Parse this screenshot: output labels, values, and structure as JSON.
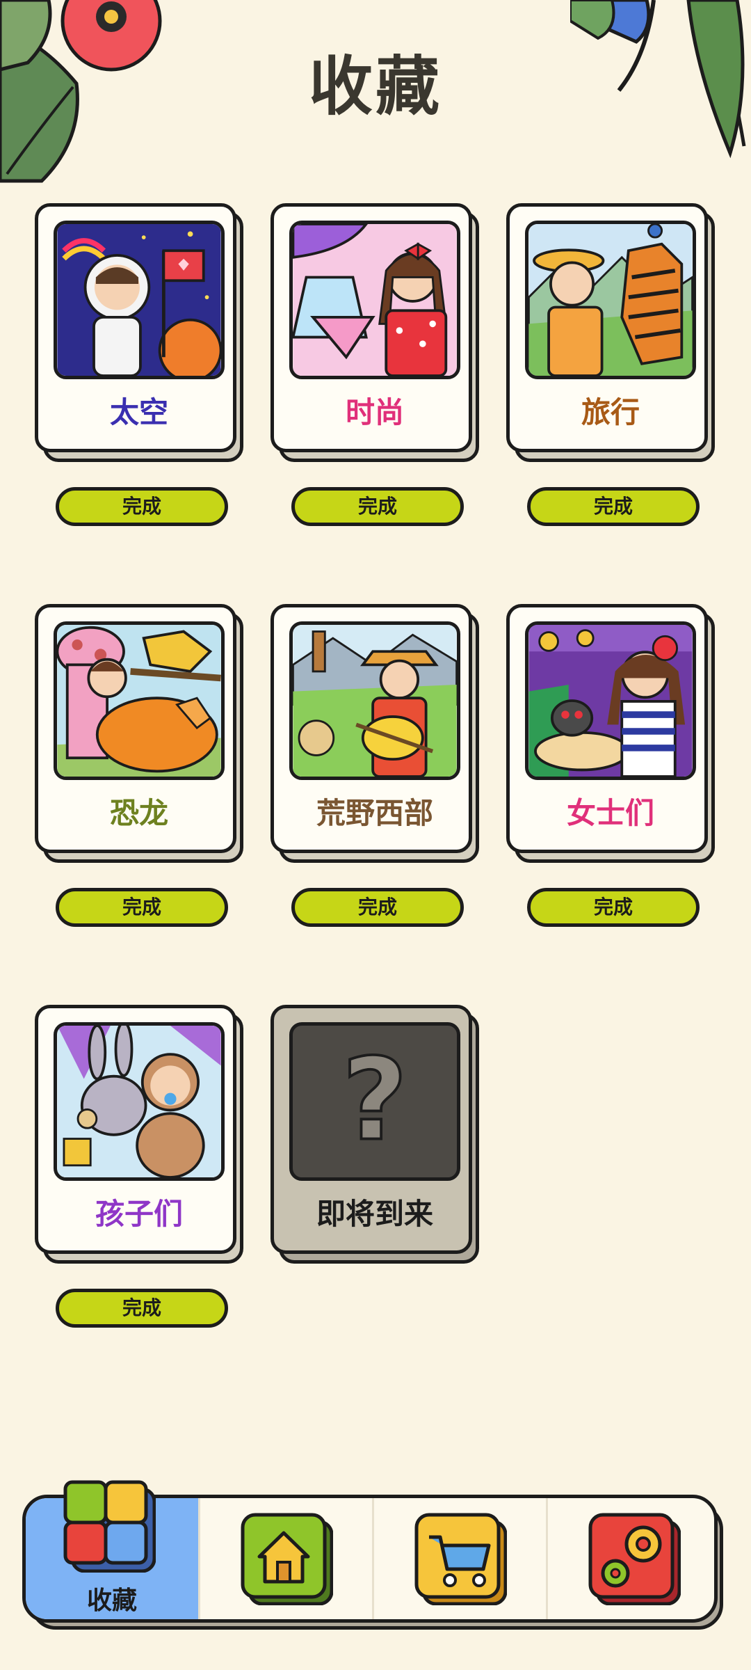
{
  "page": {
    "title": "收藏"
  },
  "collections": [
    {
      "name": "太空",
      "color": "#3a2fb0",
      "status": "完成"
    },
    {
      "name": "时尚",
      "color": "#e0307a",
      "status": "完成"
    },
    {
      "name": "旅行",
      "color": "#a85a16",
      "status": "完成"
    },
    {
      "name": "恐龙",
      "color": "#6e8120",
      "status": "完成"
    },
    {
      "name": "荒野西部",
      "color": "#7a5632",
      "status": "完成"
    },
    {
      "name": "女士们",
      "color": "#e0307a",
      "status": "完成"
    },
    {
      "name": "孩子们",
      "color": "#8f36c7",
      "status": "完成"
    },
    {
      "name": "即将到来",
      "color": "#1c1c1c",
      "locked": true
    }
  ],
  "tabbar": {
    "tabs": [
      {
        "id": "collection",
        "label": "收藏",
        "icon": "puzzle-icon",
        "active": true
      },
      {
        "id": "home",
        "icon": "home-icon"
      },
      {
        "id": "shop",
        "icon": "cart-icon"
      },
      {
        "id": "settings",
        "icon": "gear-icon"
      }
    ]
  }
}
